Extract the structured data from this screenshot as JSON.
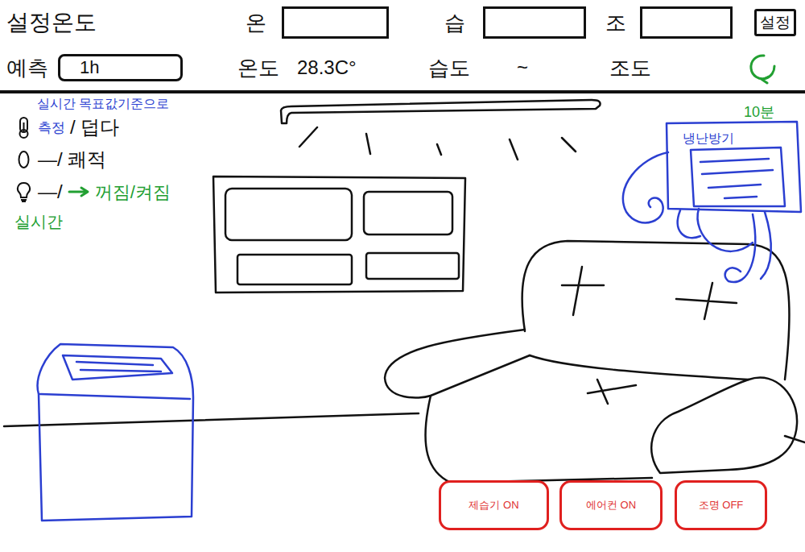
{
  "header": {
    "title": "설정온도",
    "setpoints": [
      {
        "label": "온",
        "value": ""
      },
      {
        "label": "습",
        "value": ""
      },
      {
        "label": "조",
        "value": ""
      }
    ],
    "set_button": "설정"
  },
  "forecast": {
    "label": "예측",
    "period": "1h",
    "readings": [
      {
        "label": "온도",
        "value": "28.3C°"
      },
      {
        "label": "습도",
        "value": "~"
      },
      {
        "label": "조도"
      }
    ],
    "refresh_interval": "10분"
  },
  "legend": {
    "note": "실시간 목표값기준으로",
    "rows": [
      {
        "kind": "temperature",
        "note": "측정",
        "text": "/ 덥다"
      },
      {
        "kind": "humidity",
        "text": "—/ 쾌적"
      },
      {
        "kind": "light",
        "text": "—/",
        "action": "꺼짐/켜짐"
      }
    ],
    "footer": "실시간"
  },
  "room": {
    "aircon_label": "냉난방기"
  },
  "buttons": [
    {
      "label": "제습기 ON"
    },
    {
      "label": "에어컨 ON"
    },
    {
      "label": "조명 OFF"
    }
  ]
}
